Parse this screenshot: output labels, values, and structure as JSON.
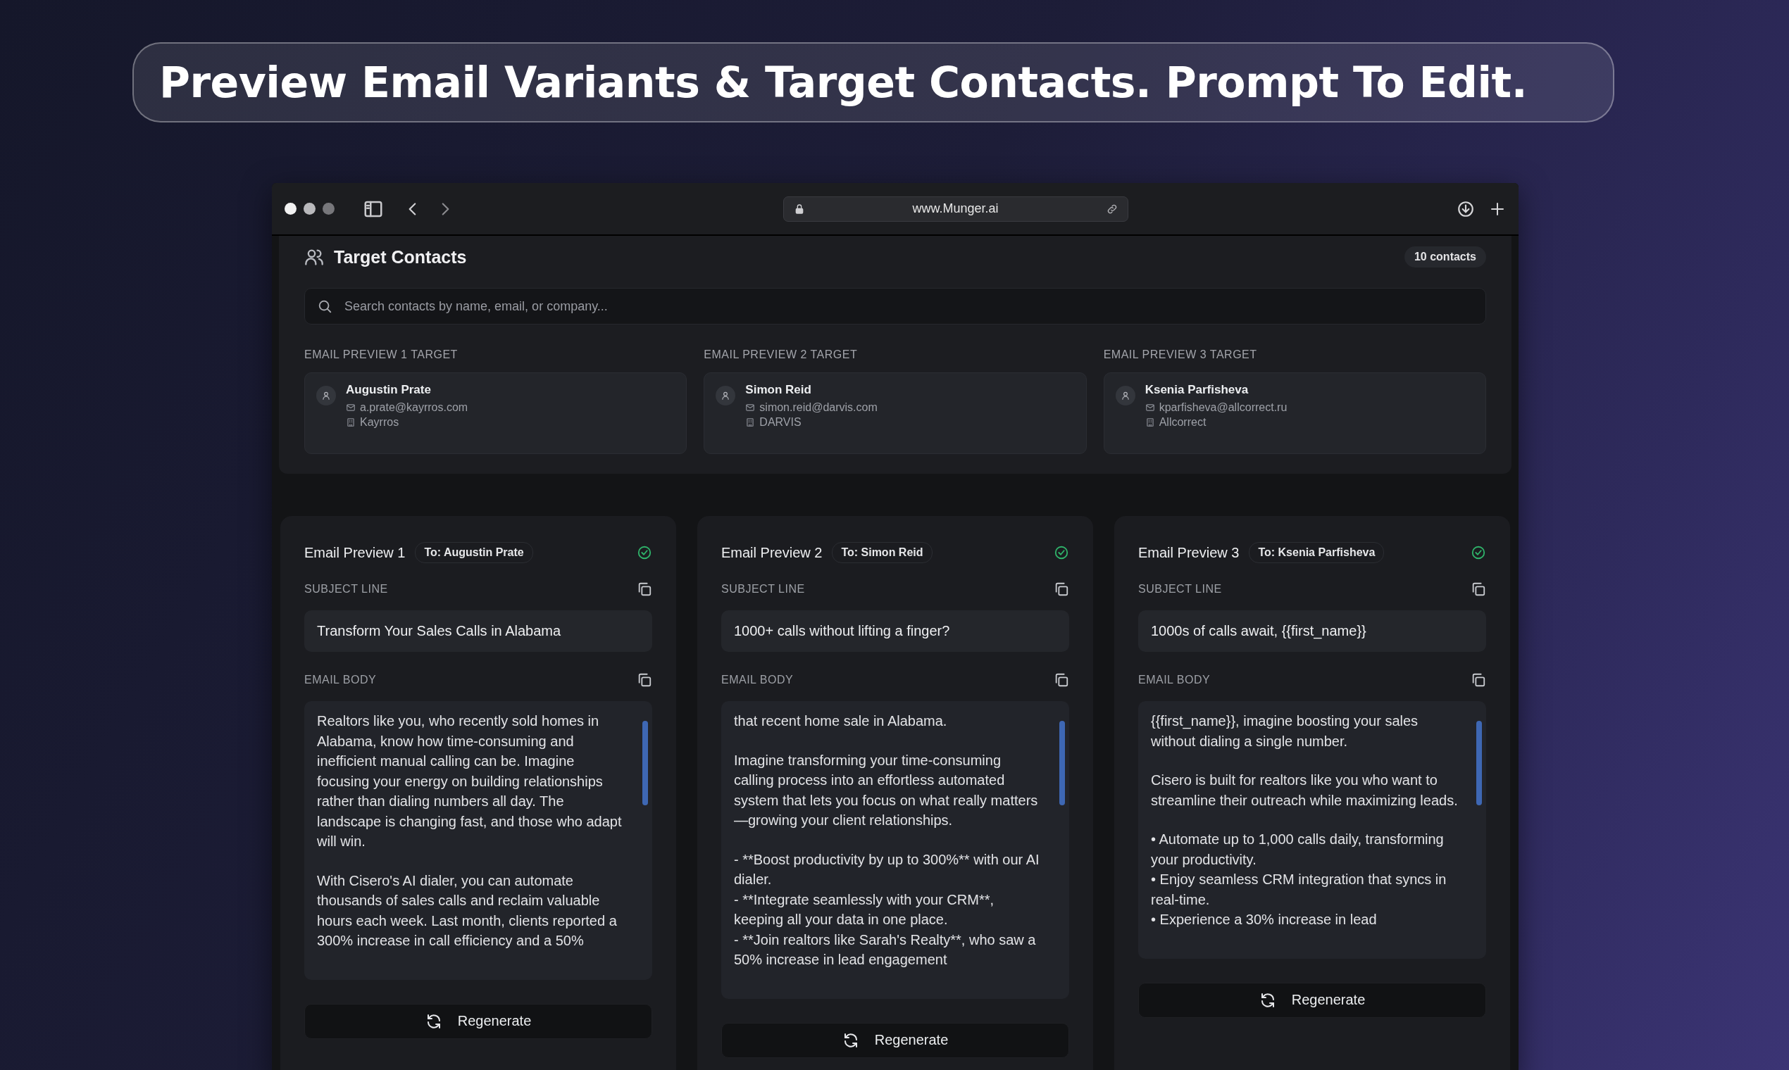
{
  "headline": "Preview Email Variants & Target Contacts. Prompt To Edit.",
  "browser": {
    "url": "www.Munger.ai"
  },
  "contacts_panel": {
    "title": "Target Contacts",
    "count": "10 contacts",
    "search": {
      "placeholder": "Search contacts by name, email, or company..."
    },
    "targets": [
      {
        "label": "EMAIL PREVIEW 1 TARGET",
        "name": "Augustin Prate",
        "email": "a.prate@kayrros.com",
        "company": "Kayrros"
      },
      {
        "label": "EMAIL PREVIEW 2 TARGET",
        "name": "Simon Reid",
        "email": "simon.reid@darvis.com",
        "company": "DARVIS"
      },
      {
        "label": "EMAIL PREVIEW 3 TARGET",
        "name": "Ksenia Parfisheva",
        "email": "kparfisheva@allcorrect.ru",
        "company": "Allcorrect"
      }
    ]
  },
  "previews": [
    {
      "title": "Email Preview 1",
      "recipient": "To: Augustin Prate",
      "subject_label": "SUBJECT LINE",
      "subject": "Transform Your Sales Calls in Alabama",
      "body_label": "EMAIL BODY",
      "body": [
        [
          "Realtors like you, who recently sold homes in Alabama, know how time-consuming and inefficient manual calling can be. Imagine focusing your energy on building relationships rather than dialing numbers all day. The landscape is changing fast, and those who adapt will win."
        ],
        [
          "With Cisero's AI dialer, you can automate thousands of sales calls and reclaim valuable hours each week. Last month, clients reported a 300% increase in call efficiency and a 50%"
        ]
      ],
      "button": "Regenerate"
    },
    {
      "title": "Email Preview 2",
      "recipient": "To: Simon Reid",
      "subject_label": "SUBJECT LINE",
      "subject": "1000+ calls without lifting a finger?",
      "body_label": "EMAIL BODY",
      "body": [
        [
          "that recent home sale in Alabama."
        ],
        [
          "Imagine transforming your time-consuming calling process into an effortless automated system that lets you focus on what really matters—growing your client relationships."
        ],
        [
          "- **Boost productivity by up to 300%** with our AI dialer.",
          "- **Integrate seamlessly with your CRM**, keeping all your data in one place.",
          "- **Join realtors like Sarah's Realty**, who saw a 50% increase in lead engagement"
        ]
      ],
      "button": "Regenerate"
    },
    {
      "title": "Email Preview 3",
      "recipient": "To: Ksenia Parfisheva",
      "subject_label": "SUBJECT LINE",
      "subject": "1000s of calls await, {{first_name}}",
      "body_label": "EMAIL BODY",
      "body": [
        [
          "{{first_name}}, imagine boosting your sales without dialing a single number."
        ],
        [
          "Cisero is built for realtors like you who want to streamline their outreach while maximizing leads."
        ],
        [
          "• Automate up to 1,000 calls daily, transforming your productivity.",
          "• Enjoy seamless CRM integration that syncs in real-time.",
          "• Experience a 30% increase in lead"
        ]
      ],
      "button": "Regenerate"
    }
  ]
}
